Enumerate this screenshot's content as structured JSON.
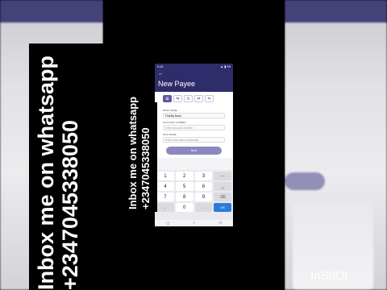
{
  "watermark": {
    "line1": "Inbox me on whatsapp",
    "line2": "+2347045338050",
    "brand": "InShOt"
  },
  "phone": {
    "status_left": "9:41",
    "status_right": "▲ ▮ 99",
    "back_icon": "arrow-left-icon",
    "title": "New Payee",
    "tabs": [
      "⊞",
      "⇆",
      "⇅",
      "⇄",
      "⇋"
    ],
    "form": {
      "bank_label": "BANK NAME",
      "bank_value": "Fidelity Bank",
      "account_label": "ACCOUNT NUMBER",
      "account_placeholder": "Enter account number",
      "nick_label": "NICK NAME",
      "nick_placeholder": "Enter nick name (optional)",
      "next_button": "Next"
    },
    "keypad": {
      "rows": [
        [
          "1",
          "2",
          "3",
          "—"
        ],
        [
          "4",
          "5",
          "6",
          "␣"
        ],
        [
          "7",
          "8",
          "9",
          "⌫"
        ],
        [
          ",",
          "0",
          ".",
          "OK"
        ]
      ]
    },
    "nav": [
      "◻",
      "○",
      "◁"
    ]
  }
}
